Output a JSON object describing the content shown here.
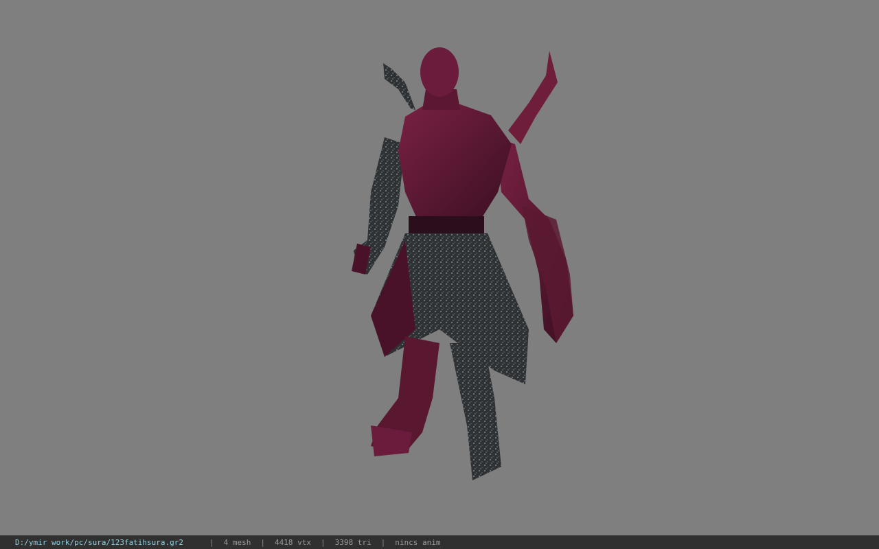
{
  "viewer": {
    "background_color": "#808080",
    "model_name": "sura character model"
  },
  "status_bar": {
    "file_path": "D:/ymir work/pc/sura/123fatihsura.gr2",
    "separator": "|",
    "mesh_count": "4 mesh",
    "vertex_count": "4418 vtx",
    "triangle_count": "3398 tri",
    "anim_status": "nincs anim"
  }
}
